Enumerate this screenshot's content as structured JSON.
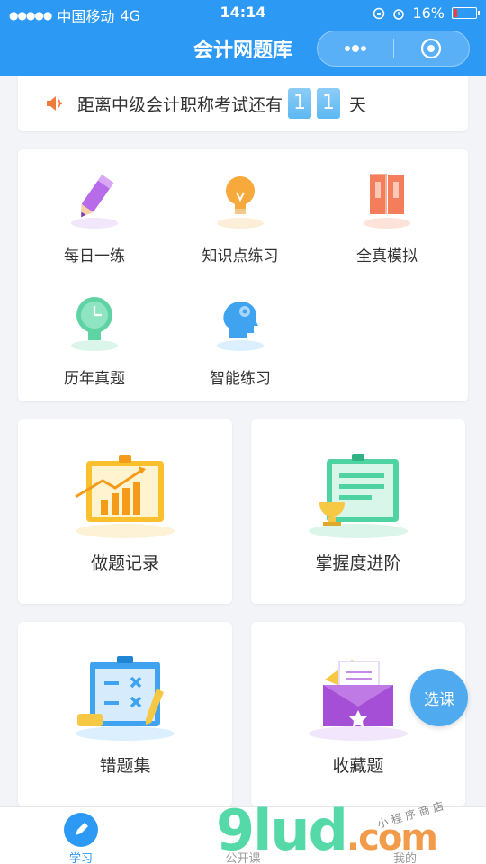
{
  "status": {
    "carrier": "中国移动",
    "network": "4G",
    "time": "14:14",
    "battery": "16%"
  },
  "nav": {
    "title": "会计网题库"
  },
  "countdown": {
    "text": "距离中级会计职称考试还有",
    "digit1": "1",
    "digit2": "1",
    "unit": "天"
  },
  "menu": {
    "items": [
      {
        "label": "每日一练",
        "icon": "pencil-icon"
      },
      {
        "label": "知识点练习",
        "icon": "lightbulb-icon"
      },
      {
        "label": "全真模拟",
        "icon": "book-icon"
      },
      {
        "label": "历年真题",
        "icon": "clock-icon"
      },
      {
        "label": "智能练习",
        "icon": "brain-icon"
      }
    ]
  },
  "tiles": [
    {
      "label": "做题记录",
      "icon": "chart-board-icon"
    },
    {
      "label": "掌握度进阶",
      "icon": "trophy-board-icon"
    },
    {
      "label": "错题集",
      "icon": "wrong-answers-icon"
    },
    {
      "label": "收藏题",
      "icon": "envelope-star-icon"
    }
  ],
  "fab": {
    "label": "选课"
  },
  "tabbar": {
    "tabs": [
      {
        "label": "学习"
      },
      {
        "label": "公开课"
      },
      {
        "label": "我的"
      }
    ]
  },
  "watermark": {
    "main": "9lud",
    "suffix": ".com",
    "sub": "小程序商店"
  },
  "colors": {
    "primary": "#2c9af5",
    "battery_low": "#ff3b30"
  }
}
